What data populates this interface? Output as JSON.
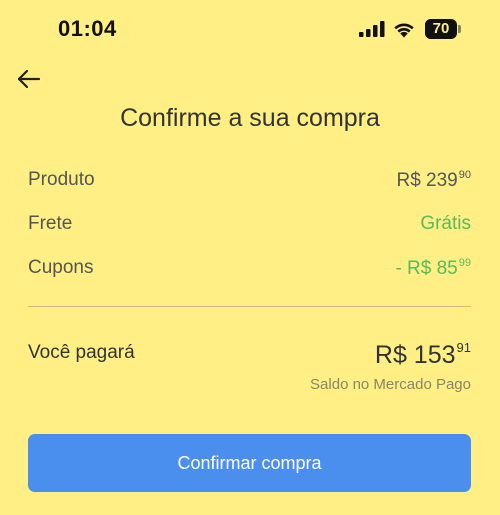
{
  "status_bar": {
    "time": "01:04",
    "battery_percent": "70",
    "battery_level_fraction": 0.7,
    "icons": [
      "signal-icon",
      "wifi-icon",
      "battery-icon"
    ]
  },
  "header": {
    "back_icon": "arrow-left-icon",
    "title": "Confirme a sua compra"
  },
  "summary": {
    "rows": [
      {
        "label": "Produto",
        "amount_main": "R$ 239",
        "amount_cents": "90",
        "color": "#555555"
      },
      {
        "label": "Frete",
        "amount_main": "Grátis",
        "amount_cents": "",
        "color": "#5BB85B"
      },
      {
        "label": "Cupons",
        "amount_main": "- R$ 85",
        "amount_cents": "99",
        "color": "#5BB85B"
      }
    ]
  },
  "total": {
    "label": "Você pagará",
    "amount_main": "R$ 153",
    "amount_cents": "91",
    "source": "Saldo no Mercado Pago"
  },
  "confirm_button": {
    "label": "Confirmar compra"
  },
  "colors": {
    "background": "#FFEF85",
    "accent_green": "#5BB85B",
    "button_blue": "#4A8FEE"
  }
}
